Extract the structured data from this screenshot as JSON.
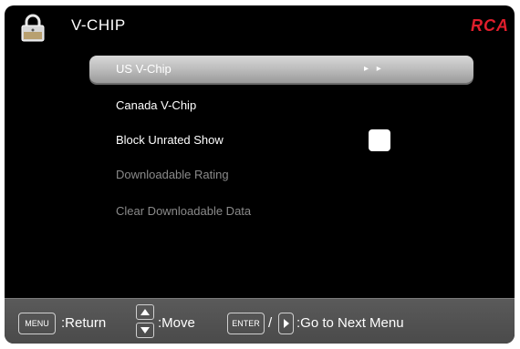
{
  "header": {
    "title": "V-CHIP",
    "brand": "RCA"
  },
  "menu": {
    "items": [
      {
        "label": "US V-Chip",
        "state": "selected",
        "indicator": "▸ ▸"
      },
      {
        "label": "Canada V-Chip",
        "state": "normal"
      },
      {
        "label": "Block Unrated Show",
        "state": "normal",
        "checkbox_checked": false
      },
      {
        "label": "Downloadable Rating",
        "state": "disabled"
      },
      {
        "label": "Clear Downloadable Data",
        "state": "disabled"
      }
    ]
  },
  "footer": {
    "menu_key": "MENU",
    "return_label": ":Return",
    "move_label": ":Move",
    "enter_key": "ENTER",
    "slash": "/",
    "next_label": ":Go to Next Menu"
  },
  "colors": {
    "background": "#000000",
    "brand": "#e01e2c",
    "selected_bar": "#bcbcbc",
    "disabled_text": "#8a8a8a",
    "footer": "#505050"
  },
  "icons": [
    "lock-icon",
    "arrow-up-icon",
    "arrow-down-icon",
    "arrow-right-icon"
  ]
}
